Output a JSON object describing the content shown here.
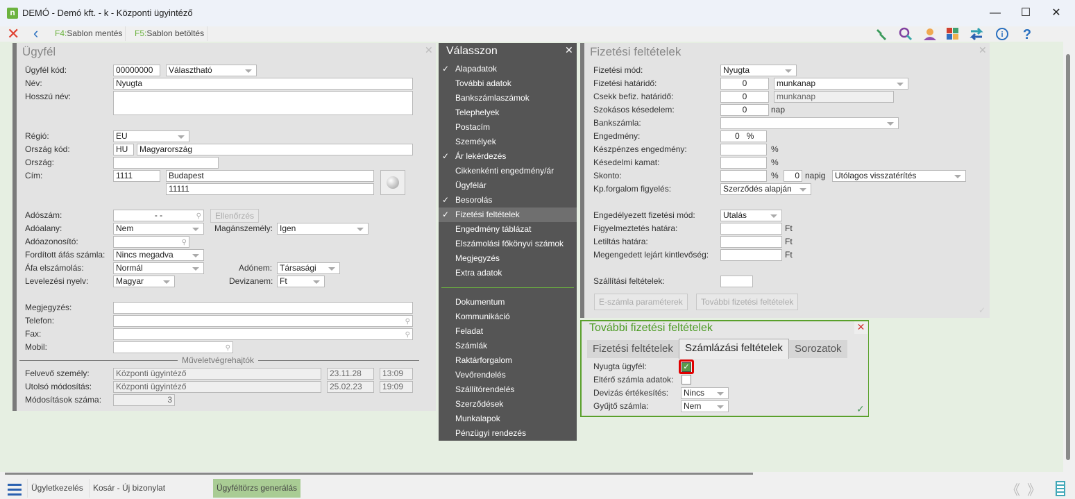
{
  "window": {
    "logo": "n",
    "title": "DEMÓ - Demó kft. - k - Központi ügyintéző",
    "minimize": "—",
    "maximize": "☐",
    "close": "✕"
  },
  "toolbar": {
    "f4_key": "F4:",
    "f4_label": "Sablon mentés",
    "f5_key": "F5:",
    "f5_label": "Sablon betöltés",
    "icons": [
      "close-icon",
      "back-icon",
      "wrench-icon",
      "search-icon",
      "user-icon",
      "tiles-icon",
      "swap-icon",
      "info-icon",
      "help-icon"
    ]
  },
  "customer": {
    "title": "Ügyfél",
    "code_label": "Ügyfél kód:",
    "code": "00000000",
    "code_type": "Választható",
    "name_label": "Név:",
    "name": "Nyugta",
    "long_name_label": "Hosszú név:",
    "long_name": "",
    "region_label": "Régió:",
    "region": "EU",
    "country_code_label": "Ország kód:",
    "country_code": "HU",
    "country_name": "Magyarország",
    "country_label": "Ország:",
    "country": "",
    "address_label": "Cím:",
    "zip": "1111",
    "city": "Budapest",
    "street": "11111",
    "tax_no_label": "Adószám:",
    "tax_no": "- -",
    "check_button": "Ellenőrzés",
    "taxable_label": "Adóalany:",
    "taxable": "Nem",
    "private_label": "Magánszemély:",
    "private": "Igen",
    "tax_id_label": "Adóazonosító:",
    "tax_id": "",
    "reverse_vat_label": "Fordított áfás számla:",
    "reverse_vat": "Nincs megadva",
    "vat_label": "Áfa elszámolás:",
    "vat": "Normál",
    "tax_type_label": "Adónem:",
    "tax_type": "Társasági",
    "language_label": "Levelezési nyelv:",
    "language": "Magyar",
    "currency_label": "Devizanem:",
    "currency": "Ft",
    "note_label": "Megjegyzés:",
    "phone_label": "Telefon:",
    "fax_label": "Fax:",
    "mobile_label": "Mobil:",
    "operators_title": "Műveletvégrehajtók",
    "created_label": "Felvevő személy:",
    "created_by": "Központi ügyintéző",
    "created_date": "23.11.28",
    "created_time": "13:09",
    "modified_label": "Utolsó módosítás:",
    "modified_by": "Központi ügyintéző",
    "modified_date": "25.02.23",
    "modified_time": "19:09",
    "mod_count_label": "Módosítások száma:",
    "mod_count": "3"
  },
  "menu": {
    "title": "Válasszon",
    "close": "✕",
    "items": [
      {
        "label": "Alapadatok",
        "checked": true
      },
      {
        "label": "További adatok"
      },
      {
        "label": "Bankszámlaszámok"
      },
      {
        "label": "Telephelyek"
      },
      {
        "label": "Postacím"
      },
      {
        "label": "Személyek"
      },
      {
        "label": "Ár lekérdezés",
        "checked": true
      },
      {
        "label": "Cikkenkénti engedmény/ár"
      },
      {
        "label": "Ügyfélár"
      },
      {
        "label": "Besorolás",
        "checked": true
      },
      {
        "label": "Fizetési feltételek",
        "checked": true,
        "selected": true
      },
      {
        "label": "Engedmény táblázat"
      },
      {
        "label": "Elszámolási főkönyvi számok"
      },
      {
        "label": "Megjegyzés"
      },
      {
        "label": "Extra adatok"
      }
    ],
    "items2": [
      {
        "label": "Dokumentum"
      },
      {
        "label": "Kommunikáció"
      },
      {
        "label": "Feladat"
      },
      {
        "label": "Számlák"
      },
      {
        "label": "Raktárforgalom"
      },
      {
        "label": "Vevőrendelés"
      },
      {
        "label": "Szállítórendelés"
      },
      {
        "label": "Szerződések"
      },
      {
        "label": "Munkalapok"
      },
      {
        "label": "Pénzügyi rendezés"
      }
    ],
    "check": "✓"
  },
  "payment": {
    "title": "Fizetési feltételek",
    "close": "✕",
    "mode_label": "Fizetési mód:",
    "mode": "Nyugta",
    "deadline_label": "Fizetési határidő:",
    "deadline": "0",
    "deadline_unit": "munkanap",
    "cheque_label": "Csekk befiz. határidő:",
    "cheque": "0",
    "cheque_unit": "munkanap",
    "delay_label": "Szokásos késedelem:",
    "delay": "0",
    "delay_unit": "nap",
    "bank_label": "Bankszámla:",
    "bank": "",
    "discount_label": "Engedmény:",
    "discount": "0",
    "percent": "%",
    "cash_discount_label": "Készpénzes engedmény:",
    "late_interest_label": "Késedelmi kamat:",
    "skonto_label": "Skonto:",
    "skonto_days": "0",
    "skonto_days_unit": "napig",
    "skonto_type": "Utólagos visszatérítés",
    "cash_watch_label": "Kp.forgalom figyelés:",
    "cash_watch": "Szerződés alapján",
    "allowed_mode_label": "Engedélyezett fizetési mód:",
    "allowed_mode": "Utalás",
    "warn_label": "Figyelmeztetés határa:",
    "block_label": "Letiltás határa:",
    "overdue_label": "Megengedett lejárt kintlevőség:",
    "ft": "Ft",
    "delivery_label": "Szállítási feltételek:",
    "einvoice_button": "E-számla paraméterek",
    "more_button": "További fizetési feltételek",
    "ok": "✓"
  },
  "more_dialog": {
    "title": "További fizetési feltételek",
    "close": "✕",
    "tabs": [
      "Fizetési feltételek",
      "Számlázási feltételek",
      "Sorozatok"
    ],
    "active_tab": 1,
    "receipt_label": "Nyugta ügyfél:",
    "receipt_checked": true,
    "diff_label": "Eltérő számla adatok:",
    "diff_checked": false,
    "fx_label": "Devizás értékesítés:",
    "fx": "Nincs",
    "collective_label": "Gyűjtő számla:",
    "collective": "Nem",
    "ok": "✓"
  },
  "bottom": {
    "menu_icon": "menu-icon",
    "items": [
      "Ügyletkezelés",
      "Kosár - Új bizonylat",
      "Ügyféltörzs generálás"
    ],
    "prev": "《",
    "next": "》"
  },
  "colors": {
    "accent": "#6cb33f",
    "menu_bg": "#555555",
    "highlight": "#e00000"
  }
}
